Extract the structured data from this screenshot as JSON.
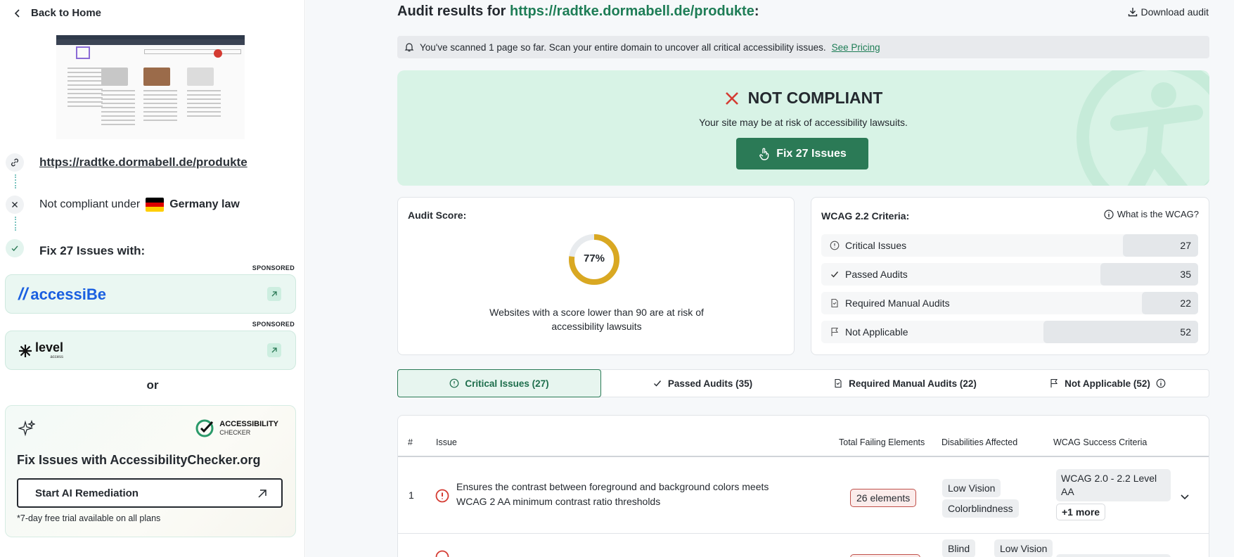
{
  "sidebar": {
    "back_label": "Back to Home",
    "site_url": "https://radtke.dormabell.de/produkte",
    "compliance_prefix": "Not compliant under",
    "compliance_law": "Germany law",
    "fix_with": "Fix 27 Issues with:",
    "sponsored_label": "SPONSORED",
    "vendors": [
      {
        "name": "accessiBe",
        "sponsored": "SPONSORED"
      },
      {
        "name": "level",
        "sub": "access",
        "sponsored": "SPONSORED"
      }
    ],
    "or_label": "or",
    "ac_card": {
      "brand_line1": "ACCESSIBILITY",
      "brand_line2": "CHECKER",
      "title": "Fix Issues with AccessibilityChecker.org",
      "button": "Start AI Remediation",
      "note": "*7-day free trial available on all plans"
    }
  },
  "header": {
    "title_prefix": "Audit results for",
    "url": "https://radtke.dormabell.de/produkte",
    "colon": ":",
    "download": "Download audit"
  },
  "notice": {
    "text": "You've scanned 1 page so far. Scan your entire domain to uncover all critical accessibility issues.",
    "link": "See Pricing"
  },
  "hero": {
    "status": "NOT COMPLIANT",
    "risk": "Your site may be at risk of accessibility lawsuits.",
    "fix_button": "Fix 27 Issues"
  },
  "score": {
    "label": "Audit Score:",
    "value": "77%",
    "percent": 77,
    "note": "Websites with a score lower than 90 are at risk of accessibility lawsuits"
  },
  "wcag": {
    "label": "WCAG 2.2 Criteria:",
    "link": "What is the WCAG?",
    "rows": [
      {
        "label": "Critical Issues",
        "count": "27",
        "icon": "alert-circle-icon",
        "fill": 0.2
      },
      {
        "label": "Passed Audits",
        "count": "35",
        "icon": "check-icon",
        "fill": 0.26
      },
      {
        "label": "Required Manual Audits",
        "count": "22",
        "icon": "document-icon",
        "fill": 0.15
      },
      {
        "label": "Not Applicable",
        "count": "52",
        "icon": "flag-icon",
        "fill": 0.41
      }
    ]
  },
  "tabs": [
    {
      "label": "Critical Issues (27)",
      "active": true
    },
    {
      "label": "Passed Audits (35)"
    },
    {
      "label": "Required Manual Audits (22)"
    },
    {
      "label": "Not Applicable (52)"
    }
  ],
  "table": {
    "headers": {
      "num": "#",
      "issue": "Issue",
      "failing": "Total Failing Elements",
      "disabilities": "Disabilities Affected",
      "wcag": "WCAG Success Criteria"
    },
    "rows": [
      {
        "num": "1",
        "issue": "Ensures the contrast between foreground and background colors meets WCAG 2 AA minimum contrast ratio thresholds",
        "failing": "26 elements",
        "disabilities": [
          "Low Vision",
          "Colorblindness"
        ],
        "wcag": "WCAG 2.0 - 2.2 Level AA",
        "more": "+1 more"
      },
      {
        "disabilities": [
          "Blind",
          "Low Vision"
        ]
      }
    ]
  },
  "colors": {
    "brand_green": "#2b7a56",
    "url_green": "#1e7d56",
    "hero_bg": "#d8f3e6",
    "error_red": "#d43b32",
    "gauge_gold": "#d9a822"
  }
}
